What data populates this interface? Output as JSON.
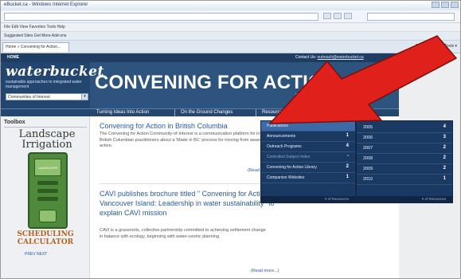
{
  "browser": {
    "title": "eBucket.ca - Windows Internet Explorer",
    "menu": "File Edit View Favorites Tools Help",
    "favorites_label": "Suggested Sites  Get More Add-ons",
    "tab_label": "Home » Convening for Action...",
    "tab_right": "Page ▾  Safety ▾  Tools ▾"
  },
  "site": {
    "home_label": "HOME",
    "contact_label": "Contact Us:",
    "contact_email": "outreach@waterbucket.ca",
    "logo": "waterbucket",
    "tagline": "sustainable approaches to integrated water management",
    "community_select": "Communities of Interest",
    "banner_title": "CONVENING FOR ACTION",
    "search_label": "search"
  },
  "nav": {
    "items": [
      "Turning Ideas Into Action",
      "On the Ground Changes",
      "Resources"
    ]
  },
  "sidebar": {
    "title": "Toolbox",
    "ad_title_line1": "Landscape",
    "ad_title_line2": "Irrigation",
    "device_label": "LANDSCAPE",
    "ad_bottom_line1": "SCHEDULING",
    "ad_bottom_line2": "CALCULATOR",
    "prev_next": "PREV  NEXT"
  },
  "articles": [
    {
      "title": "Convening for Action in British Columbia",
      "body": "The Convening for Action Community-of-Interest is a communication platform for informing British Columbian practitioners about a 'Made in BC' process for moving from awareness to action.",
      "read_more": "(Read more...)"
    },
    {
      "title": "CAVI publishes brochure titled \" Convening for Action on Vancouver Island: Leadership in water sustainability\" to explain CAVI mission",
      "body": "CAVI is a grassroots, collective partnership committed to achieving settlement change in balance with ecology, beginning with water-centric planning.",
      "read_more": "(Read more...)"
    }
  ],
  "resources_menu": {
    "items": [
      {
        "label": "Publications",
        "count": ""
      },
      {
        "label": "Announcements",
        "count": "1"
      },
      {
        "label": "Outreach Programs",
        "count": "4"
      },
      {
        "label": "Controlled Subject Index",
        "count": "-"
      },
      {
        "label": "Convening for Action Library",
        "count": "2"
      },
      {
        "label": "Companion Websites",
        "count": "1"
      }
    ],
    "footer": "# of Resources"
  },
  "years_menu": {
    "items": [
      {
        "label": "2005",
        "count": "4"
      },
      {
        "label": "2006",
        "count": "3"
      },
      {
        "label": "2007",
        "count": "2"
      },
      {
        "label": "2008",
        "count": "2"
      },
      {
        "label": "2009",
        "count": "2"
      },
      {
        "label": "2010",
        "count": "1"
      }
    ],
    "footer": "# of Resources"
  },
  "colors": {
    "header_blue": "#2d537f",
    "link_blue": "#2759a8",
    "arrow_red": "#e0201a"
  }
}
